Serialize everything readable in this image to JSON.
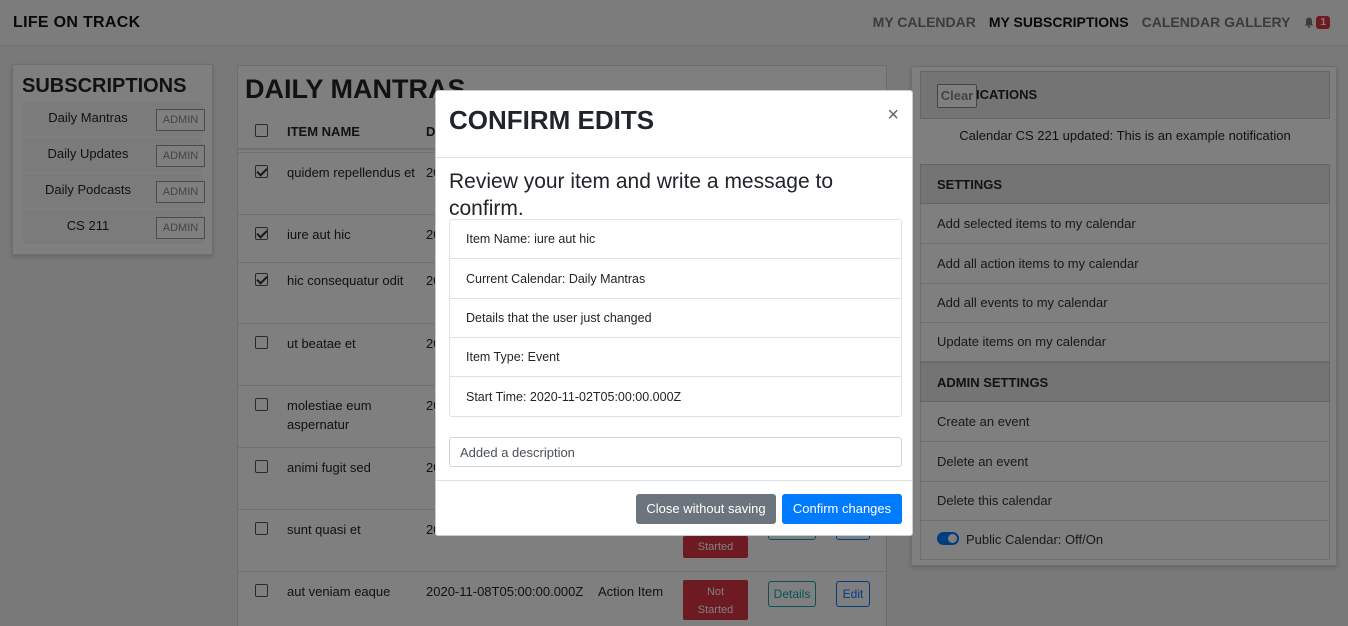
{
  "navbar": {
    "brand": "LIFE ON TRACK",
    "links": [
      "MY CALENDAR",
      "MY SUBSCRIPTIONS",
      "CALENDAR GALLERY"
    ],
    "notification_count": "1"
  },
  "subscriptions": {
    "title": "SUBSCRIPTIONS",
    "admin_label": "ADMIN",
    "items": [
      "Daily Mantras",
      "Daily Updates",
      "Daily Podcasts",
      "CS 211"
    ]
  },
  "main": {
    "title": "DAILY MANTRAS",
    "headers": [
      "ITEM NAME",
      "D"
    ],
    "rows": [
      {
        "name": "quidem repellendus et",
        "date": "20",
        "checked": true
      },
      {
        "name": "iure aut hic",
        "date": "20",
        "checked": true
      },
      {
        "name": "hic consequatur odit",
        "date": "20",
        "checked": true
      },
      {
        "name": "ut beatae et",
        "date": "20",
        "checked": false
      },
      {
        "name": "molestiae eum aspernatur",
        "date": "20",
        "checked": false
      },
      {
        "name": "animi fugit sed",
        "date": "20",
        "checked": false
      },
      {
        "name": "sunt quasi et",
        "date": "20",
        "checked": false
      },
      {
        "name": "aut veniam eaque",
        "date": "2020-11-08T05:00:00.000Z",
        "type": "Action Item",
        "status": "Not Started",
        "details": "Details",
        "edit": "Edit",
        "checked": false
      }
    ],
    "partial_status": "Started"
  },
  "notifications": {
    "title": "NOTIFICATIONS",
    "clear": "Clear",
    "text": "Calendar CS 221 updated: This is an example notification"
  },
  "settings": {
    "title": "SETTINGS",
    "items": [
      "Add selected items to my calendar",
      "Add all action items to my calendar",
      "Add all events to my calendar",
      "Update items on my calendar"
    ]
  },
  "admin_settings": {
    "title": "ADMIN SETTINGS",
    "items": [
      "Create an event",
      "Delete an event",
      "Delete this calendar"
    ],
    "toggle_label": "Public Calendar: Off/On"
  },
  "modal": {
    "title": "CONFIRM EDITS",
    "close": "×",
    "lead": "Review your item and write a message to confirm.",
    "info": [
      "Item Name: iure aut hic",
      "Current Calendar: Daily Mantras",
      "Details that the user just changed",
      "Item Type: Event",
      "Start Time: 2020-11-02T05:00:00.000Z"
    ],
    "input_value": "Added a description",
    "cancel": "Close without saving",
    "confirm": "Confirm changes"
  },
  "colors": {
    "primary": "#007bff",
    "secondary": "#6c757d",
    "danger": "#dc3545",
    "info": "#17a2b8"
  }
}
